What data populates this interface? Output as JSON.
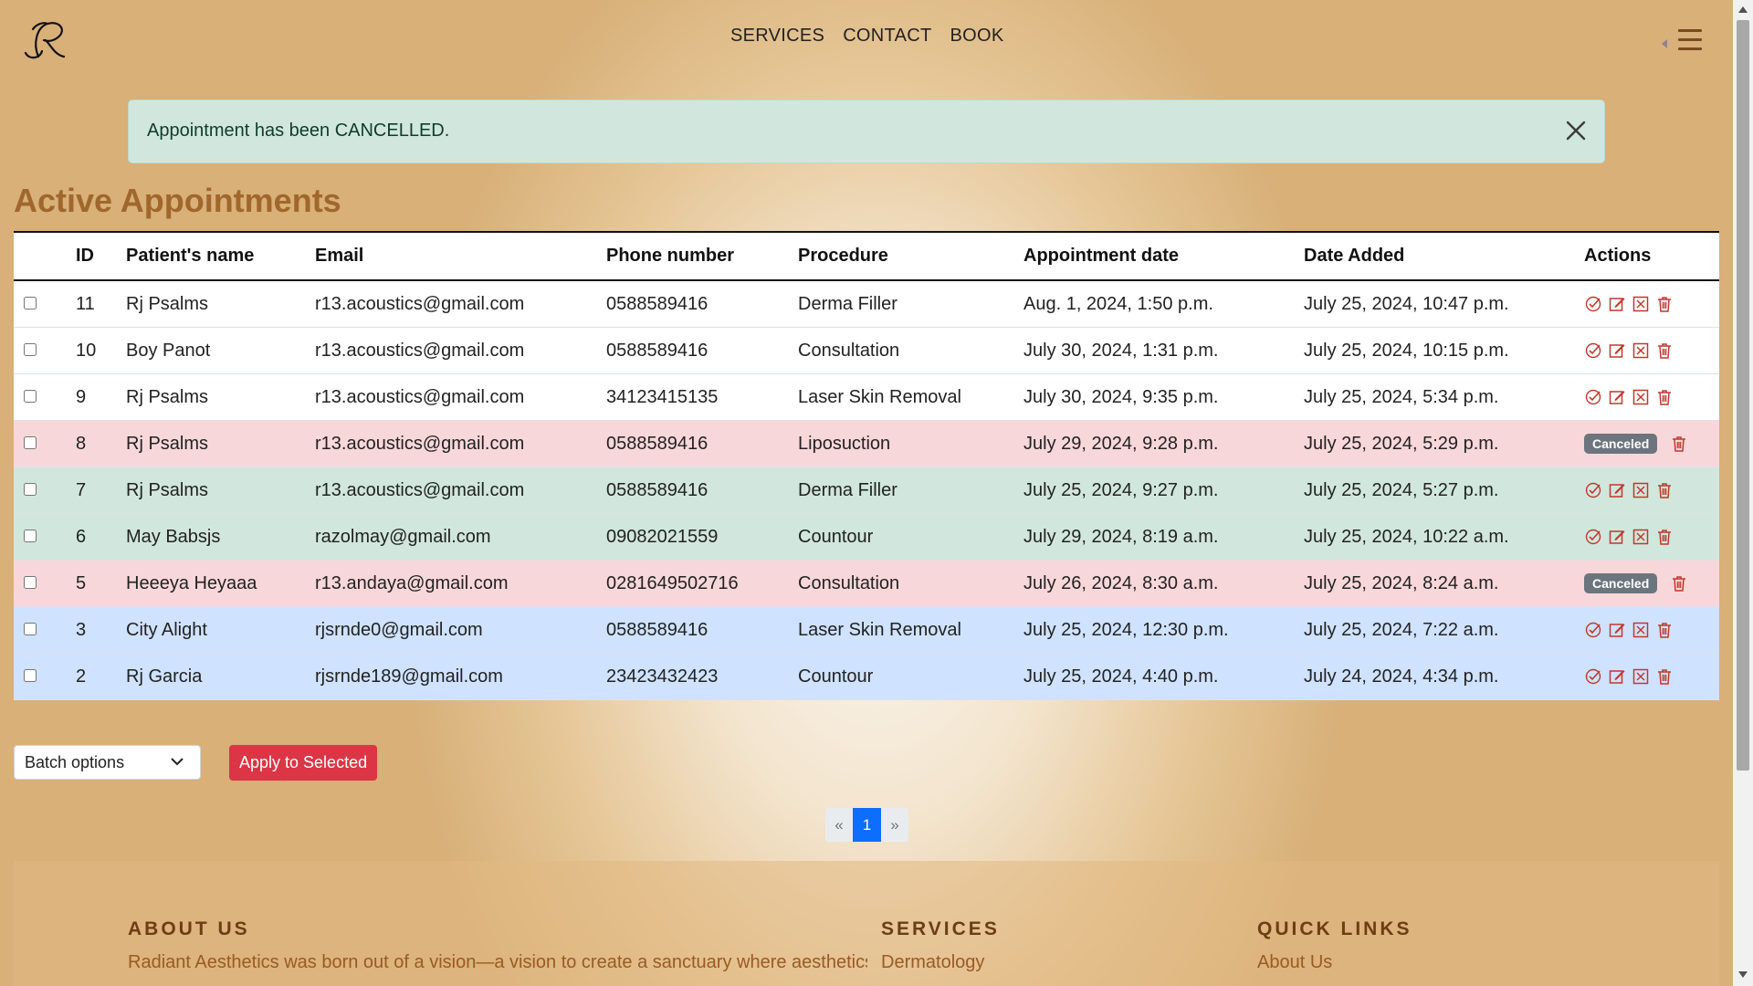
{
  "header": {
    "nav": [
      "SERVICES",
      "CONTACT",
      "BOOK"
    ]
  },
  "alert": {
    "message": "Appointment has been CANCELLED."
  },
  "section_title": "Active Appointments",
  "table": {
    "columns": [
      "ID",
      "Patient's name",
      "Email",
      "Phone number",
      "Procedure",
      "Appointment date",
      "Date Added",
      "Actions"
    ],
    "rows": [
      {
        "id": "11",
        "name": "Rj Psalms",
        "email": "r13.acoustics@gmail.com",
        "phone": "0588589416",
        "procedure": "Derma Filler",
        "appt": "Aug. 1, 2024, 1:50 p.m.",
        "added": "July 25, 2024, 10:47 p.m.",
        "status": "active",
        "row_color": "white"
      },
      {
        "id": "10",
        "name": "Boy Panot",
        "email": "r13.acoustics@gmail.com",
        "phone": "0588589416",
        "procedure": "Consultation",
        "appt": "July 30, 2024, 1:31 p.m.",
        "added": "July 25, 2024, 10:15 p.m.",
        "status": "active",
        "row_color": "white"
      },
      {
        "id": "9",
        "name": "Rj Psalms",
        "email": "r13.acoustics@gmail.com",
        "phone": "34123415135",
        "procedure": "Laser Skin Removal",
        "appt": "July 30, 2024, 9:35 p.m.",
        "added": "July 25, 2024, 5:34 p.m.",
        "status": "active",
        "row_color": "white"
      },
      {
        "id": "8",
        "name": "Rj Psalms",
        "email": "r13.acoustics@gmail.com",
        "phone": "0588589416",
        "procedure": "Liposuction",
        "appt": "July 29, 2024, 9:28 p.m.",
        "added": "July 25, 2024, 5:29 p.m.",
        "status": "canceled",
        "row_color": "red"
      },
      {
        "id": "7",
        "name": "Rj Psalms",
        "email": "r13.acoustics@gmail.com",
        "phone": "0588589416",
        "procedure": "Derma Filler",
        "appt": "July 25, 2024, 9:27 p.m.",
        "added": "July 25, 2024, 5:27 p.m.",
        "status": "active",
        "row_color": "green"
      },
      {
        "id": "6",
        "name": "May Babsjs",
        "email": "razolmay@gmail.com",
        "phone": "09082021559",
        "procedure": "Countour",
        "appt": "July 29, 2024, 8:19 a.m.",
        "added": "July 25, 2024, 10:22 a.m.",
        "status": "active",
        "row_color": "green"
      },
      {
        "id": "5",
        "name": "Heeeya Heyaaa",
        "email": "r13.andaya@gmail.com",
        "phone": "0281649502716",
        "procedure": "Consultation",
        "appt": "July 26, 2024, 8:30 a.m.",
        "added": "July 25, 2024, 8:24 a.m.",
        "status": "canceled",
        "row_color": "red"
      },
      {
        "id": "3",
        "name": "City Alight",
        "email": "rjsrnde0@gmail.com",
        "phone": "0588589416",
        "procedure": "Laser Skin Removal",
        "appt": "July 25, 2024, 12:30 p.m.",
        "added": "July 25, 2024, 7:22 a.m.",
        "status": "active",
        "row_color": "blue"
      },
      {
        "id": "2",
        "name": "Rj Garcia",
        "email": "rjsrnde189@gmail.com",
        "phone": "23423432423",
        "procedure": "Countour",
        "appt": "July 25, 2024, 4:40 p.m.",
        "added": "July 24, 2024, 4:34 p.m.",
        "status": "active",
        "row_color": "blue"
      }
    ],
    "canceled_label": "Canceled",
    "action_icons": [
      "confirm-icon",
      "edit-icon",
      "cancel-icon",
      "trash-icon"
    ]
  },
  "batch": {
    "select_value": "Batch options",
    "apply_label": "Apply to Selected"
  },
  "pagination": {
    "prev": "«",
    "current": "1",
    "next": "»"
  },
  "footer": {
    "about_heading": "ABOUT US",
    "about_text": "Radiant Aesthetics was born out of a vision—a vision to create a sanctuary where aesthetics",
    "services_heading": "SERVICES",
    "services_item": "Dermatology",
    "links_heading": "QUICK LINKS",
    "links_item": "About Us"
  },
  "colors": {
    "accent_title": "#a0672d",
    "alert_bg": "#d1e7dd",
    "row_canceled": "#f8d7da",
    "row_green": "#d1e7dd",
    "row_blue": "#cfe2ff",
    "apply_button": "#dc3545",
    "page_active": "#0d6efd",
    "badge_canceled": "#6c757d"
  }
}
